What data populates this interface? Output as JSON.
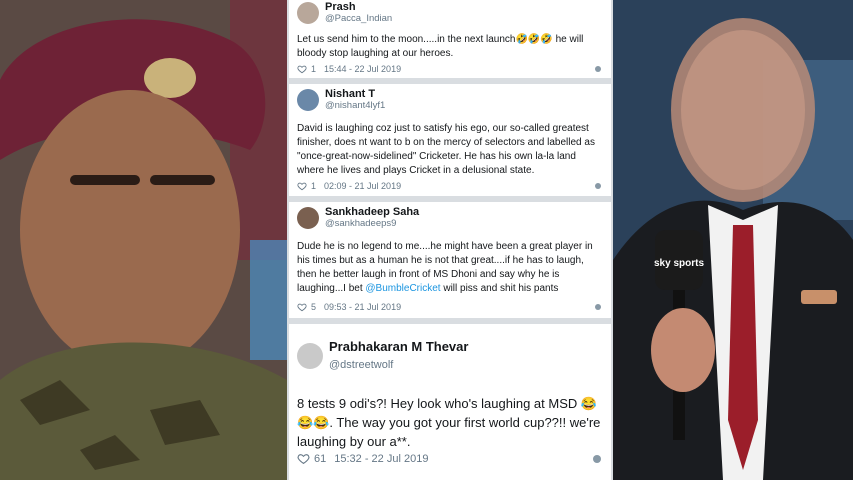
{
  "tweets": [
    {
      "name": "Prash",
      "handle": "@Pacca_Indian",
      "text": "Let us send him to the moon.....in the next launch🤣🤣🤣 he will bloody stop laughing at our heroes.",
      "likes": "1",
      "time": "15:44 - 22 Jul 2019"
    },
    {
      "name": "Nishant T",
      "handle": "@nishant4lyf1",
      "text": "David is laughing coz just to satisfy his ego, our so-called greatest finisher, does nt want to b on the mercy of selectors and labelled as \"once-great-now-sidelined\" Cricketer. He has his own la-la land where he lives and plays Cricket in a delusional state.",
      "likes": "1",
      "time": "02:09 - 21 Jul 2019"
    },
    {
      "name": "Sankhadeep Saha",
      "handle": "@sankhadeeps9",
      "text_before": "Dude he is no legend to me....he might have been a great player in his times but as a human he is not that great....if he has to laugh, then he better laugh in front of MS Dhoni and say why he is laughing...I bet ",
      "mention": "@BumbleCricket",
      "text_after": " will piss and shit his pants",
      "likes": "5",
      "time": "09:53 - 21 Jul 2019"
    },
    {
      "name": "Prabhakaran M Thevar",
      "handle": "@dstreetwolf",
      "text": "8 tests 9 odi's?! Hey look who's laughing at MSD 😂😂😂. The way you got your first world cup??!! we're laughing by our a**.",
      "likes": "61",
      "time": "15:32 - 22 Jul 2019"
    }
  ],
  "logo_text": "sky sports",
  "colors": {
    "background": "#d9dde1",
    "text": "#14171a",
    "secondary": "#657786",
    "link": "#1b95e0",
    "heart": "#657786"
  }
}
